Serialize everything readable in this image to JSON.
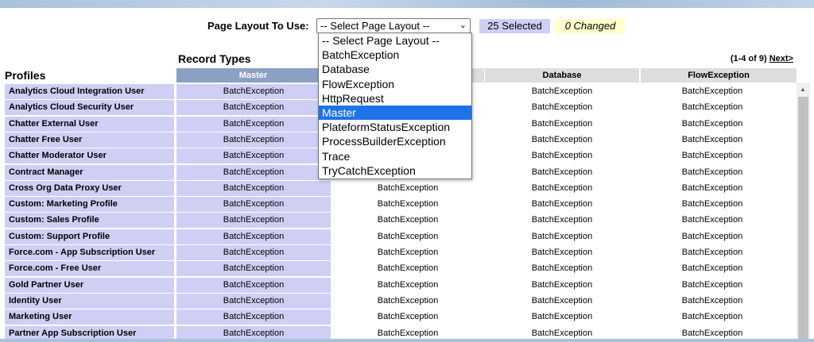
{
  "layout": {
    "label": "Page Layout To Use:",
    "select_value": "-- Select Page Layout --",
    "selected_count": "25 Selected",
    "changed_count": "0 Changed",
    "options": [
      "-- Select Page Layout --",
      "BatchException",
      "Database",
      "FlowException",
      "HttpRequest",
      "Master",
      "PlateformStatusException",
      "ProcessBuilderException",
      "Trace",
      "TryCatchException"
    ],
    "highlighted_option": "Master"
  },
  "table": {
    "record_types_label": "Record Types",
    "profiles_label": "Profiles",
    "pagination_text": "(1-4 of 9)",
    "next_label": "Next>",
    "columns": [
      "Master",
      "",
      "Database",
      "FlowException"
    ],
    "rows": [
      {
        "profile": "Analytics Cloud Integration User",
        "cells": [
          "BatchException",
          "",
          "BatchException",
          "BatchException"
        ]
      },
      {
        "profile": "Analytics Cloud Security User",
        "cells": [
          "BatchException",
          "",
          "BatchException",
          "BatchException"
        ]
      },
      {
        "profile": "Chatter External User",
        "cells": [
          "BatchException",
          "",
          "BatchException",
          "BatchException"
        ]
      },
      {
        "profile": "Chatter Free User",
        "cells": [
          "BatchException",
          "",
          "BatchException",
          "BatchException"
        ]
      },
      {
        "profile": "Chatter Moderator User",
        "cells": [
          "BatchException",
          "",
          "BatchException",
          "BatchException"
        ]
      },
      {
        "profile": "Contract Manager",
        "cells": [
          "BatchException",
          "",
          "BatchException",
          "BatchException"
        ]
      },
      {
        "profile": "Cross Org Data Proxy User",
        "cells": [
          "BatchException",
          "BatchException",
          "BatchException",
          "BatchException"
        ]
      },
      {
        "profile": "Custom: Marketing Profile",
        "cells": [
          "BatchException",
          "BatchException",
          "BatchException",
          "BatchException"
        ]
      },
      {
        "profile": "Custom: Sales Profile",
        "cells": [
          "BatchException",
          "BatchException",
          "BatchException",
          "BatchException"
        ]
      },
      {
        "profile": "Custom: Support Profile",
        "cells": [
          "BatchException",
          "BatchException",
          "BatchException",
          "BatchException"
        ]
      },
      {
        "profile": "Force.com - App Subscription User",
        "cells": [
          "BatchException",
          "BatchException",
          "BatchException",
          "BatchException"
        ]
      },
      {
        "profile": "Force.com - Free User",
        "cells": [
          "BatchException",
          "BatchException",
          "BatchException",
          "BatchException"
        ]
      },
      {
        "profile": "Gold Partner User",
        "cells": [
          "BatchException",
          "BatchException",
          "BatchException",
          "BatchException"
        ]
      },
      {
        "profile": "Identity User",
        "cells": [
          "BatchException",
          "BatchException",
          "BatchException",
          "BatchException"
        ]
      },
      {
        "profile": "Marketing User",
        "cells": [
          "BatchException",
          "BatchException",
          "BatchException",
          "BatchException"
        ]
      },
      {
        "profile": "Partner App Subscription User",
        "cells": [
          "BatchException",
          "BatchException",
          "BatchException",
          "BatchException"
        ]
      }
    ]
  },
  "icons": {
    "select_chevron": "chevron-down-icon",
    "scroll_up": "scroll-up-arrow-icon"
  }
}
